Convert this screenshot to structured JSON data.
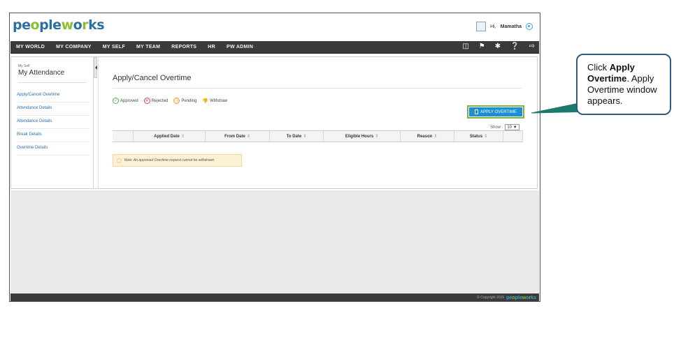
{
  "header": {
    "logo_main": "pe",
    "logo_o": "o",
    "logo_rest": "ple",
    "logo_w": "w",
    "logo_o2": "o",
    "logo_end": "rks",
    "greeting": "Hi,",
    "user_name": "Mamatha"
  },
  "nav": {
    "items": [
      "MY WORLD",
      "MY COMPANY",
      "MY SELF",
      "MY TEAM",
      "REPORTS",
      "HR",
      "PW ADMIN"
    ],
    "tools": [
      "book-icon",
      "flag-icon",
      "tools-icon",
      "help-icon",
      "logout-icon"
    ]
  },
  "sidebar": {
    "breadcrumb": "My Self",
    "title": "My Attendance",
    "items": [
      "Apply/Cancel Overtime",
      "Attendance Details",
      "Attendance Details",
      "Break Details",
      "Overtime Details"
    ]
  },
  "main": {
    "page_title": "Apply/Cancel Overtime",
    "legend": {
      "approved": "Approved",
      "rejected": "Rejected",
      "pending": "Pending",
      "withdraw": "Withdraw"
    },
    "apply_button": "APPLY OVERTIME",
    "show_label": "Show :",
    "show_value": "10",
    "columns": [
      "",
      "Applied Date",
      "From Date",
      "To Date",
      "Eligible Hours",
      "Reason",
      "Status",
      ""
    ],
    "note": "Note: An approved Overtime request cannot be withdrawn."
  },
  "footer": {
    "copyright": "© Copyright 2015",
    "logo": "peopleworks"
  },
  "callout": {
    "prefix": "Click ",
    "bold": "Apply Overtime",
    "suffix": ". Apply Overtime window appears."
  },
  "colors": {
    "nav_bg": "#3a3a3a",
    "accent_blue": "#1c8fd0",
    "highlight_green": "#7cb342",
    "callout_border": "#2a5a85",
    "link": "#2a6fb0"
  }
}
